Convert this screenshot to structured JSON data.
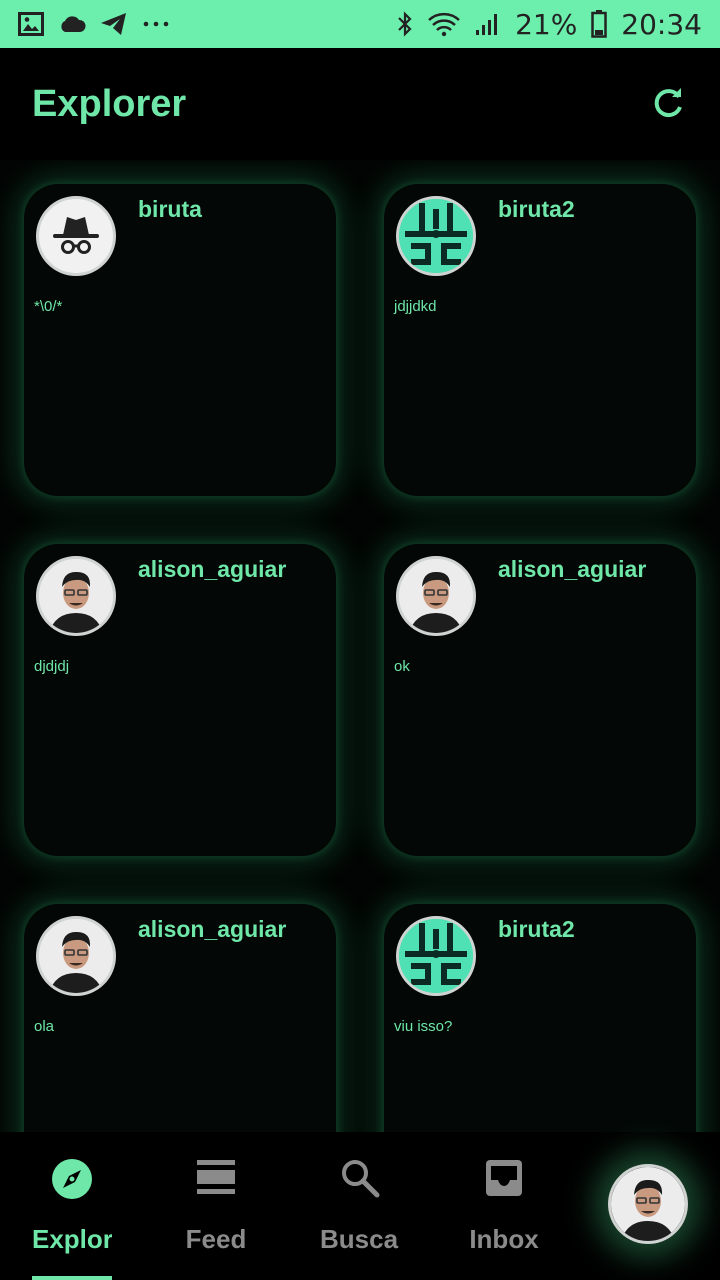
{
  "status_bar": {
    "battery": "21%",
    "time": "20:34",
    "icons_left": [
      "image-icon",
      "cloud-icon",
      "telegram-icon",
      "more-icon"
    ],
    "icons_right": [
      "bluetooth-icon",
      "wifi-icon",
      "signal-icon",
      "battery-icon"
    ]
  },
  "header": {
    "title": "Explorer",
    "refresh_icon": "refresh-icon"
  },
  "cards": [
    {
      "name": "biruta",
      "text": "*\\0/*",
      "avatar": "incognito"
    },
    {
      "name": "biruta2",
      "text": "jdjjdkd",
      "avatar": "pattern"
    },
    {
      "name": "alison_aguiar",
      "text": "djdjdj",
      "avatar": "person"
    },
    {
      "name": "alison_aguiar",
      "text": "ok",
      "avatar": "person"
    },
    {
      "name": "alison_aguiar",
      "text": "ola",
      "avatar": "person"
    },
    {
      "name": "biruta2",
      "text": "viu isso?",
      "avatar": "pattern"
    }
  ],
  "bottom_nav": {
    "items": [
      {
        "label": "Explorer",
        "icon": "compass-icon",
        "active": true
      },
      {
        "label": "Feed",
        "icon": "feed-icon",
        "active": false
      },
      {
        "label": "Busca",
        "icon": "search-icon",
        "active": false
      },
      {
        "label": "Inbox",
        "icon": "inbox-icon",
        "active": false
      }
    ],
    "profile_avatar": "person"
  },
  "colors": {
    "accent": "#6ee7a8",
    "status_bar": "#6cefac",
    "background": "#000000",
    "inactive": "#8b8b8b"
  }
}
